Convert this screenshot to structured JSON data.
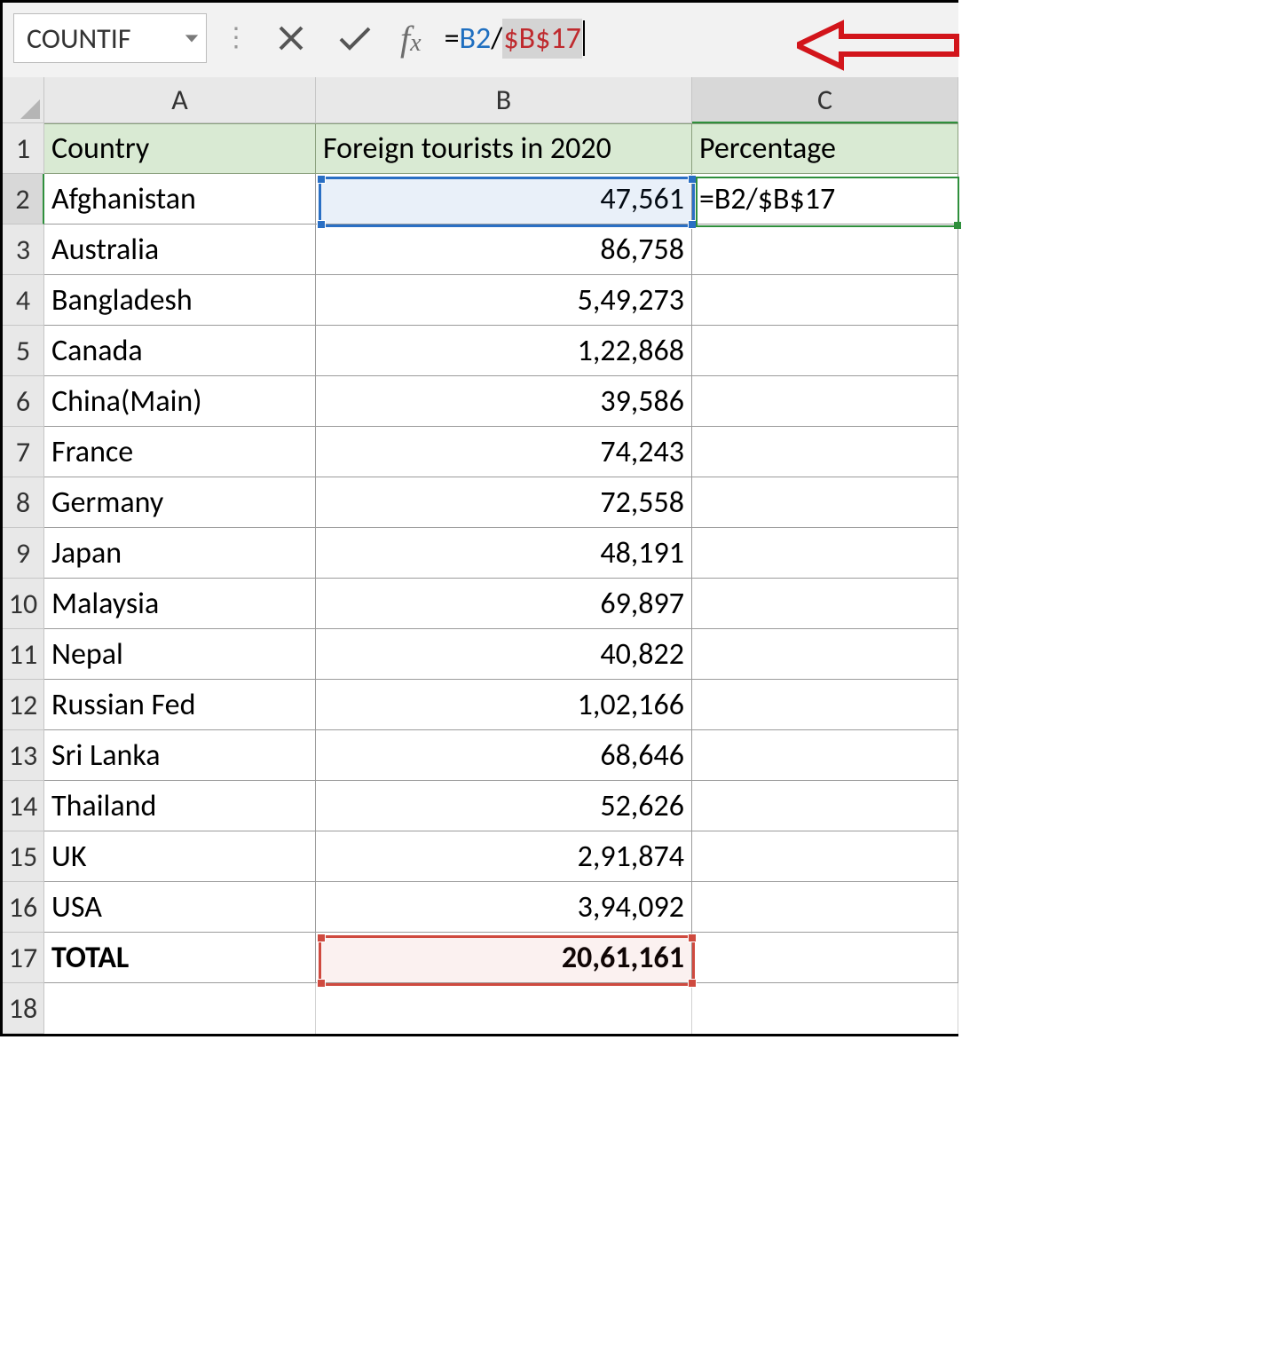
{
  "formula_bar": {
    "name_box": "COUNTIF",
    "formula_prefix": "=",
    "ref1": "B2",
    "slash": "/",
    "ref2": "$B$17"
  },
  "columns": [
    "A",
    "B",
    "C"
  ],
  "headers": {
    "a": "Country",
    "b": "Foreign tourists in 2020",
    "c": "Percentage"
  },
  "rows": [
    {
      "n": "2",
      "a": "Afghanistan",
      "b": "47,561",
      "c": "=B2/$B$17"
    },
    {
      "n": "3",
      "a": "Australia",
      "b": "86,758",
      "c": ""
    },
    {
      "n": "4",
      "a": "Bangladesh",
      "b": "5,49,273",
      "c": ""
    },
    {
      "n": "5",
      "a": "Canada",
      "b": "1,22,868",
      "c": ""
    },
    {
      "n": "6",
      "a": "China(Main)",
      "b": "39,586",
      "c": ""
    },
    {
      "n": "7",
      "a": "France",
      "b": "74,243",
      "c": ""
    },
    {
      "n": "8",
      "a": "Germany",
      "b": "72,558",
      "c": ""
    },
    {
      "n": "9",
      "a": "Japan",
      "b": "48,191",
      "c": ""
    },
    {
      "n": "10",
      "a": "Malaysia",
      "b": "69,897",
      "c": ""
    },
    {
      "n": "11",
      "a": "Nepal",
      "b": "40,822",
      "c": ""
    },
    {
      "n": "12",
      "a": "Russian Fed",
      "b": "1,02,166",
      "c": ""
    },
    {
      "n": "13",
      "a": "Sri Lanka",
      "b": "68,646",
      "c": ""
    },
    {
      "n": "14",
      "a": "Thailand",
      "b": "52,626",
      "c": ""
    },
    {
      "n": "15",
      "a": "UK",
      "b": "2,91,874",
      "c": ""
    },
    {
      "n": "16",
      "a": "USA",
      "b": "3,94,092",
      "c": ""
    }
  ],
  "total_row": {
    "n": "17",
    "a": "TOTAL",
    "b": "20,61,161",
    "c": ""
  },
  "rownums": [
    "1",
    "2",
    "3",
    "4",
    "5",
    "6",
    "7",
    "8",
    "9",
    "10",
    "11",
    "12",
    "13",
    "14",
    "15",
    "16",
    "17",
    "18"
  ]
}
